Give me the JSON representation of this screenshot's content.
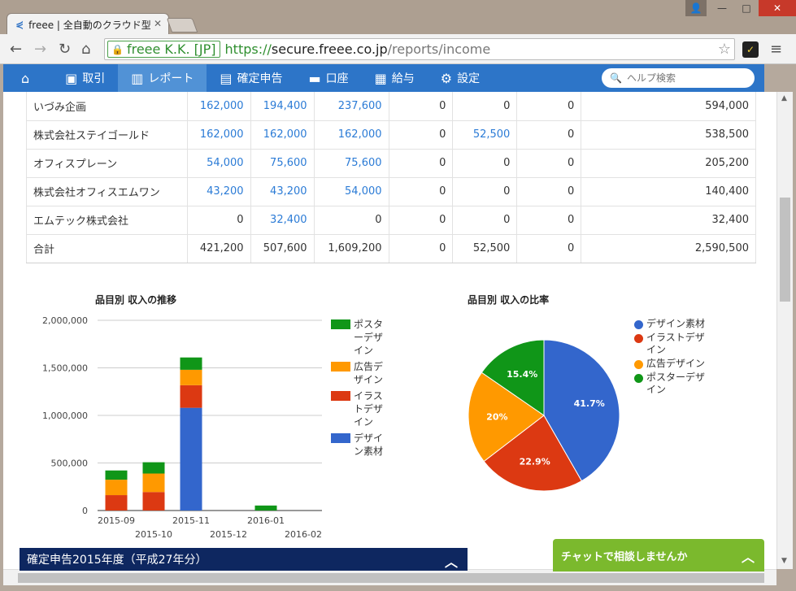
{
  "browser": {
    "tab_title": "freee | 全自動のクラウド型会計",
    "ev_label": "freee K.K. [JP]",
    "url_scheme": "https://",
    "url_host": "secure.freee.co.jp",
    "url_path": "/reports/income"
  },
  "nav": {
    "items": [
      {
        "label": "",
        "icon": "home-icon"
      },
      {
        "label": "取引",
        "icon": "inbox-icon"
      },
      {
        "label": "レポート",
        "icon": "chart-icon",
        "active": true
      },
      {
        "label": "確定申告",
        "icon": "books-icon"
      },
      {
        "label": "口座",
        "icon": "card-icon"
      },
      {
        "label": "給与",
        "icon": "calendar-icon"
      },
      {
        "label": "設定",
        "icon": "gear-icon"
      }
    ],
    "help_placeholder": "ヘルプ検索"
  },
  "table": {
    "rows": [
      {
        "name": "いづみ企画",
        "cells": [
          "162,000",
          "194,400",
          "237,600",
          "0",
          "0",
          "0",
          "594,000"
        ]
      },
      {
        "name": "株式会社ステイゴールド",
        "cells": [
          "162,000",
          "162,000",
          "162,000",
          "0",
          "52,500",
          "0",
          "538,500"
        ]
      },
      {
        "name": "オフィスプレーン",
        "cells": [
          "54,000",
          "75,600",
          "75,600",
          "0",
          "0",
          "0",
          "205,200"
        ]
      },
      {
        "name": "株式会社オフィスエムワン",
        "cells": [
          "43,200",
          "43,200",
          "54,000",
          "0",
          "0",
          "0",
          "140,400"
        ]
      },
      {
        "name": "エムテック株式会社",
        "cells": [
          "0",
          "32,400",
          "0",
          "0",
          "0",
          "0",
          "32,400"
        ]
      },
      {
        "name": "合計",
        "cells": [
          "421,200",
          "507,600",
          "1,609,200",
          "0",
          "52,500",
          "0",
          "2,590,500"
        ]
      }
    ]
  },
  "chart_data": [
    {
      "type": "bar",
      "stacked": true,
      "title": "品目別 収入の推移",
      "categories": [
        "2015-09",
        "2015-10",
        "2015-11",
        "2015-12",
        "2016-01",
        "2016-02"
      ],
      "ylim": [
        0,
        2000000
      ],
      "y_ticks": [
        "0",
        "500,000",
        "1,000,000",
        "1,500,000",
        "2,000,000"
      ],
      "series": [
        {
          "name": "デザイン素材",
          "color": "#3366cc",
          "values": [
            0,
            0,
            1080000,
            0,
            0,
            0
          ]
        },
        {
          "name": "イラストデザイン",
          "color": "#dc3912",
          "values": [
            162000,
            194400,
            237600,
            0,
            0,
            0
          ]
        },
        {
          "name": "広告デザイン",
          "color": "#ff9900",
          "values": [
            162000,
            194400,
            162000,
            0,
            0,
            0
          ]
        },
        {
          "name": "ポスターデザイン",
          "color": "#109618",
          "values": [
            97200,
            118800,
            129600,
            0,
            52500,
            0
          ]
        }
      ],
      "legend_order": [
        "ポスターデザイン",
        "広告デザイン",
        "イラストデザイン",
        "デザイン素材"
      ],
      "legend_placement": "right"
    },
    {
      "type": "pie",
      "title": "品目別 収入の比率",
      "slices": [
        {
          "name": "デザイン素材",
          "value": 41.7,
          "label": "41.7%",
          "color": "#3366cc"
        },
        {
          "name": "イラストデザイン",
          "value": 22.9,
          "label": "22.9%",
          "color": "#dc3912"
        },
        {
          "name": "広告デザイン",
          "value": 20.0,
          "label": "20%",
          "color": "#ff9900"
        },
        {
          "name": "ポスターデザイン",
          "value": 15.4,
          "label": "15.4%",
          "color": "#109618"
        }
      ],
      "legend_placement": "right"
    }
  ],
  "footer": {
    "tax_bar_label": "確定申告2015年度（平成27年分）",
    "chat_label": "チャットで相談しませんか"
  }
}
